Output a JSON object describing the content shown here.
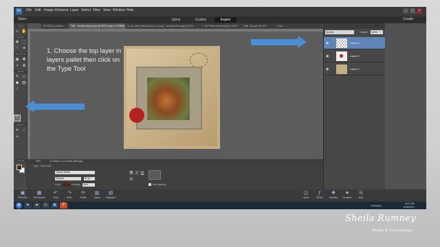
{
  "app": {
    "menu": [
      "File",
      "Edit",
      "Image",
      "Enhance",
      "Layer",
      "Select",
      "Filter",
      "View",
      "Window",
      "Help"
    ],
    "open_label": "Open",
    "modes": [
      "Quick",
      "Guided",
      "Expert"
    ],
    "create_label": "Create"
  },
  "doc_tabs": [
    "20120323_sublime...",
    "Title - chicken layout.psd @ 50% (Layer 4, RGB/8)",
    "ss_do_t0bk_floral_journal_hk.png",
    "sc.chaameron.jpg @ 25%",
    "Old Photo frames.png @ 100%",
    "Milk Cap.psd @ 67%",
    "Eat ..."
  ],
  "toolbox": {
    "sections": [
      "VIEW",
      "SELECT",
      "ENHANCE",
      "DRAW",
      "MODIFY",
      "COLOR"
    ],
    "tools": [
      "zoom-icon",
      "hand-icon",
      "move-icon",
      "marquee-icon",
      "lasso-icon",
      "magic-wand-icon",
      "eye-icon",
      "healing-icon",
      "sponge-icon",
      "clone-icon",
      "brush-icon",
      "eraser-icon",
      "bucket-icon",
      "gradient-icon",
      "eyedropper-icon",
      "type-icon",
      "crop-icon",
      "recompose-icon",
      "straighten-icon"
    ],
    "fg_color": "#4a2a10",
    "bg_color": "#ffffff"
  },
  "instruction": "1. Choose the  top layer in layers pallet then click on the Type Tool",
  "status": {
    "zoom": "50%",
    "doc_size": "12 inches x 12 inches (300 ppi)"
  },
  "tool_options": {
    "panel_label": "Type - Horizontal",
    "font": "Typical Writer",
    "style": "Regular",
    "size": "90 pt",
    "leading_label": "Leading",
    "leading": "Auto",
    "color_label": "Color",
    "anti_alias": "Anti-aliasing"
  },
  "layers": {
    "blend_mode": "Normal",
    "opacity_label": "Opacity:",
    "opacity": "100%",
    "items": [
      {
        "name": "Layer 4",
        "selected": true
      },
      {
        "name": "Layer 5",
        "selected": false
      },
      {
        "name": "Layer 3",
        "selected": false
      }
    ]
  },
  "bottom_left": [
    {
      "icon": "photo-bin-icon",
      "label": "Photo Bin"
    },
    {
      "icon": "tool-options-icon",
      "label": "Tool Options"
    },
    {
      "icon": "undo-icon",
      "label": "Undo"
    },
    {
      "icon": "redo-icon",
      "label": "Redo"
    },
    {
      "icon": "rotate-icon",
      "label": "Rotate"
    },
    {
      "icon": "layout-icon",
      "label": "Layout"
    },
    {
      "icon": "organizer-icon",
      "label": "Organizer"
    }
  ],
  "bottom_right": [
    {
      "icon": "layers-icon",
      "label": "Layers"
    },
    {
      "icon": "effects-icon",
      "label": "Effects"
    },
    {
      "icon": "graphics-icon",
      "label": "Graphics"
    },
    {
      "icon": "favorites-icon",
      "label": "Favorites"
    },
    {
      "icon": "more-icon",
      "label": "More"
    }
  ],
  "taskbar": {
    "apps": [
      "ie-icon",
      "folder-icon",
      "chrome-icon",
      "ps-icon",
      "ppt-icon"
    ],
    "desktop_label": "Desktop",
    "time": "8:07 PM",
    "date": "3/18/2013"
  },
  "signature": {
    "name": "Sheila Rumney",
    "subtitle": "Design & Photography"
  }
}
